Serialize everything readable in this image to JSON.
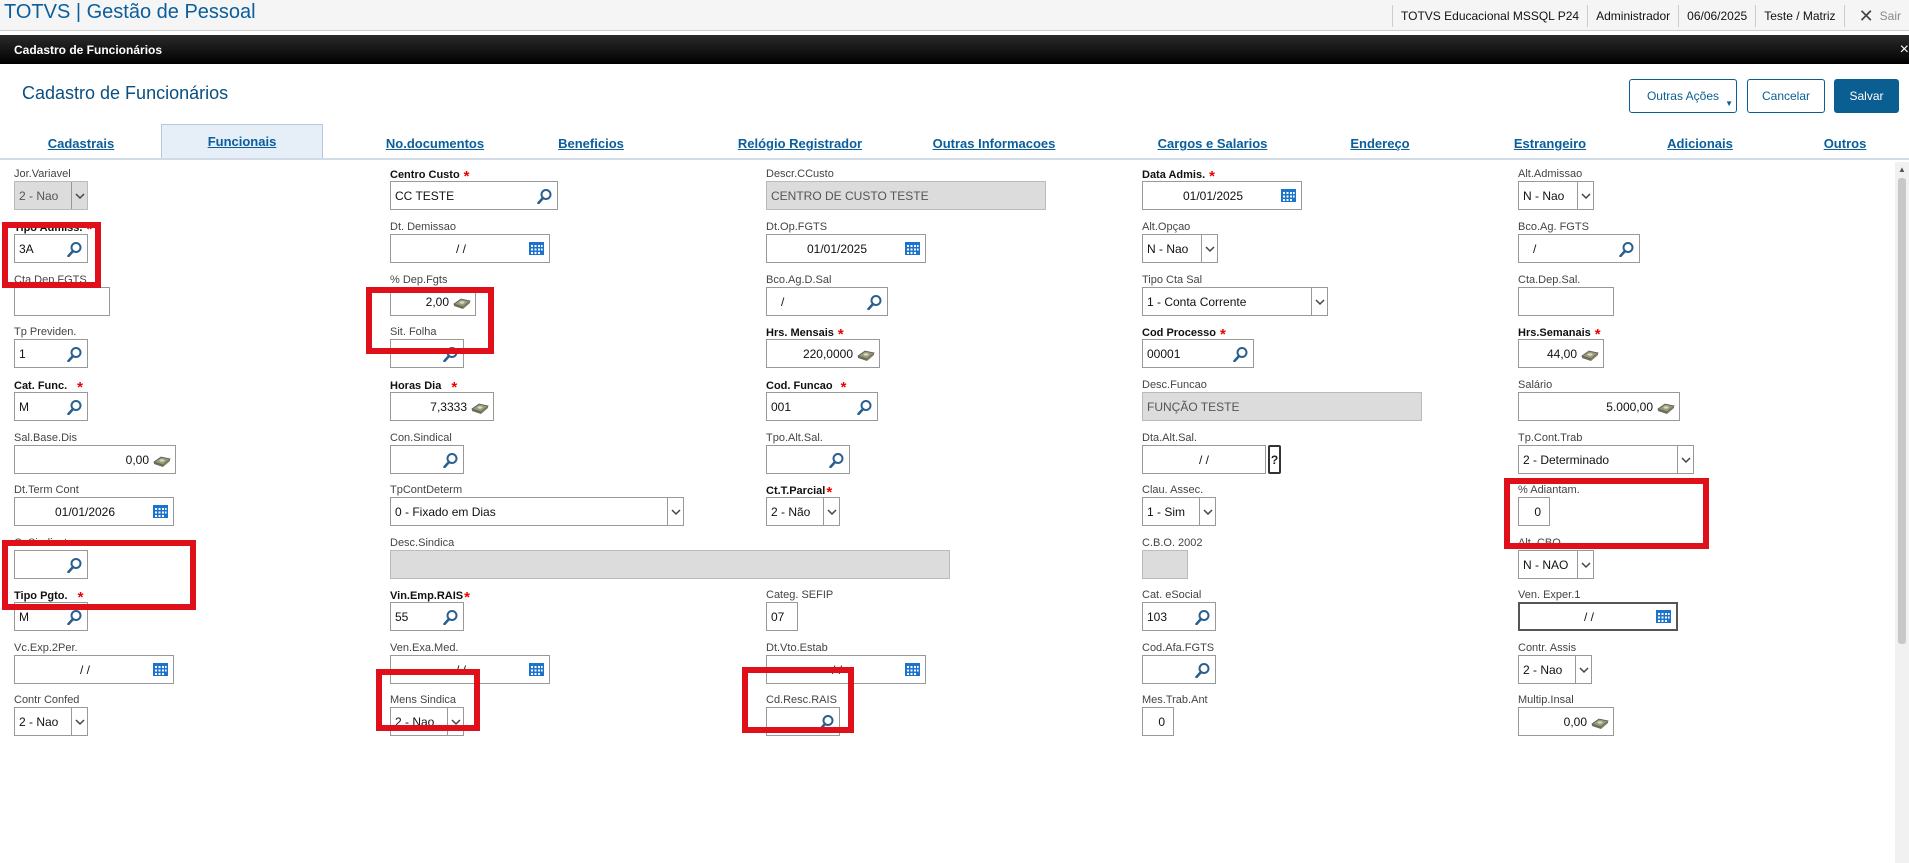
{
  "topbar": {
    "app_title": "TOTVS | Gestão de Pessoal",
    "environment": "TOTVS Educacional MSSQL P24",
    "user": "Administrador",
    "date": "06/06/2025",
    "branch": "Teste / Matriz",
    "exit_label": "Sair"
  },
  "window": {
    "title": "Cadastro de Funcionários",
    "close_label": "×"
  },
  "page": {
    "title": "Cadastro de Funcionários",
    "buttons": {
      "other_actions": "Outras Ações",
      "cancel": "Cancelar",
      "save": "Salvar"
    }
  },
  "tabs": [
    "Cadastrais",
    "Funcionais",
    "No.documentos",
    "Beneficios",
    "Relógio Registrador",
    "Outras Informacoes",
    "Cargos e Salarios",
    "Endereço",
    "Estrangeiro",
    "Adicionais",
    "Outros"
  ],
  "active_tab": "Funcionais",
  "fields": {
    "jor_variavel": {
      "label": "Jor.Variavel",
      "value": "2 - Nao"
    },
    "centro_custo": {
      "label": "Centro Custo",
      "value": "CC TESTE"
    },
    "descr_ccusto": {
      "label": "Descr.CCusto",
      "value": "CENTRO DE CUSTO TESTE"
    },
    "data_admis": {
      "label": "Data Admis.",
      "value": "01/01/2025"
    },
    "alt_admissao": {
      "label": "Alt.Admissao",
      "value": "N - Nao"
    },
    "tipo_admiss": {
      "label": "Tipo Admiss.",
      "value": "3A"
    },
    "dt_demissao": {
      "label": "Dt. Demissao",
      "value": "/ /"
    },
    "dt_op_fgts": {
      "label": "Dt.Op.FGTS",
      "value": "01/01/2025"
    },
    "alt_opcao": {
      "label": "Alt.Opçao",
      "value": "N - Nao"
    },
    "bco_ag_fgts": {
      "label": "Bco.Ag. FGTS",
      "value": "/"
    },
    "cta_dep_fgts": {
      "label": "Cta.Dep.FGTS",
      "value": ""
    },
    "pct_dep_fgts": {
      "label": "% Dep.Fgts",
      "value": "2,00"
    },
    "bco_ag_d_sal": {
      "label": "Bco.Ag.D.Sal",
      "value": "/"
    },
    "tipo_cta_sal": {
      "label": "Tipo Cta Sal",
      "value": "1 - Conta Corrente"
    },
    "cta_dep_sal": {
      "label": "Cta.Dep.Sal.",
      "value": ""
    },
    "tp_previden": {
      "label": "Tp Previden.",
      "value": "1"
    },
    "sit_folha": {
      "label": "Sit. Folha",
      "value": ""
    },
    "hrs_mensais": {
      "label": "Hrs. Mensais",
      "value": "220,0000"
    },
    "cod_processo": {
      "label": "Cod Processo",
      "value": "00001"
    },
    "hrs_semanais": {
      "label": "Hrs.Semanais",
      "value": "44,00"
    },
    "cat_func": {
      "label": "Cat. Func.",
      "value": "M"
    },
    "horas_dia": {
      "label": "Horas Dia",
      "value": "7,3333"
    },
    "cod_funcao": {
      "label": "Cod. Funcao",
      "value": "001"
    },
    "desc_funcao": {
      "label": "Desc.Funcao",
      "value": "FUNÇÃO TESTE"
    },
    "salario": {
      "label": "Salário",
      "value": "5.000,00"
    },
    "sal_base_dis": {
      "label": "Sal.Base.Dis",
      "value": "0,00"
    },
    "con_sindical": {
      "label": "Con.Sindical",
      "value": ""
    },
    "tpo_alt_sal": {
      "label": "Tpo.Alt.Sal.",
      "value": ""
    },
    "dta_alt_sal": {
      "label": "Dta.Alt.Sal.",
      "value": "/ /",
      "help": "?"
    },
    "tp_cont_trab": {
      "label": "Tp.Cont.Trab",
      "value": "2 - Determinado"
    },
    "dt_term_cont": {
      "label": "Dt.Term Cont",
      "value": "01/01/2026"
    },
    "tp_cont_determ": {
      "label": "TpContDeterm",
      "value": "0 - Fixado em Dias"
    },
    "ct_t_parcial": {
      "label": "Ct.T.Parcial",
      "value": "2 - Não"
    },
    "clau_assec": {
      "label": "Clau. Assec.",
      "value": "1 - Sim"
    },
    "pct_adiantam": {
      "label": "% Adiantam.",
      "value": "0"
    },
    "c_sindicato": {
      "label": "C. Sindicato",
      "value": ""
    },
    "desc_sindica": {
      "label": "Desc.Sindica",
      "value": ""
    },
    "cbo_2002": {
      "label": "C.B.O. 2002",
      "value": ""
    },
    "alt_cbo": {
      "label": "Alt. CBO",
      "value": "N - NAO"
    },
    "tipo_pgto": {
      "label": "Tipo Pgto.",
      "value": "M"
    },
    "vin_emp_rais": {
      "label": "Vin.Emp.RAIS",
      "value": "55"
    },
    "categ_sefip": {
      "label": "Categ. SEFIP",
      "value": "07"
    },
    "cat_esocial": {
      "label": "Cat. eSocial",
      "value": "103"
    },
    "ven_exper1": {
      "label": "Ven. Exper.1",
      "value": "/ /"
    },
    "vc_exp_2per": {
      "label": "Vc.Exp.2Per.",
      "value": "/ /"
    },
    "ven_exa_med": {
      "label": "Ven.Exa.Med.",
      "value": "/ /"
    },
    "dt_vto_estab": {
      "label": "Dt.Vto.Estab",
      "value": "/ /"
    },
    "cod_afa_fgts": {
      "label": "Cod.Afa.FGTS",
      "value": ""
    },
    "contr_assis": {
      "label": "Contr. Assis",
      "value": "2 - Nao"
    },
    "contr_confed": {
      "label": "Contr Confed",
      "value": "2 - Nao"
    },
    "mens_sindica": {
      "label": "Mens Sindica",
      "value": "2 - Nao"
    },
    "cd_resc_rais": {
      "label": "Cd.Resc.RAIS",
      "value": ""
    },
    "mes_trab_ant": {
      "label": "Mes.Trab.Ant",
      "value": "0"
    },
    "multip_insal": {
      "label": "Multip.Insal",
      "value": "0,00"
    }
  },
  "colors": {
    "brand": "#0a5e9c",
    "highlight": "#e0101a",
    "required": "#e00000"
  }
}
